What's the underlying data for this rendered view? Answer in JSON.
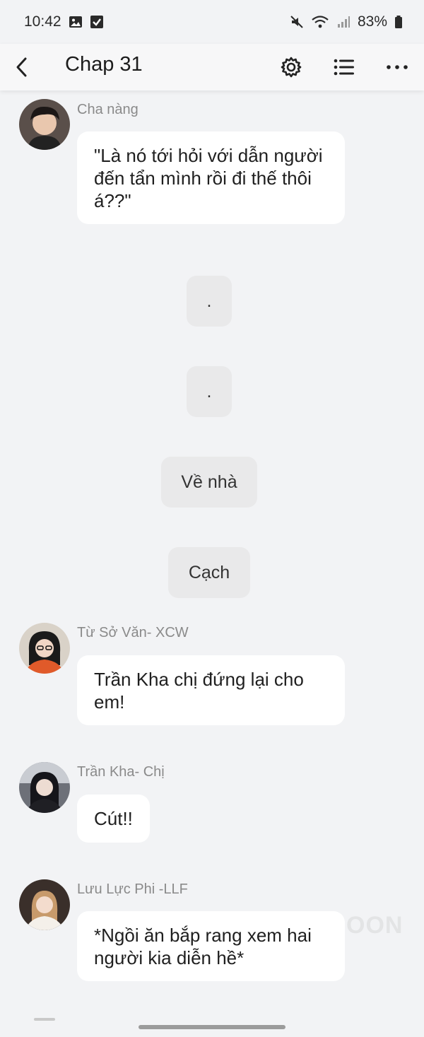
{
  "status_bar": {
    "time": "10:42",
    "battery": "83%"
  },
  "header": {
    "title": "Chap 31"
  },
  "messages": [
    {
      "sender": "Cha nàng",
      "text": "\"Là nó tới hỏi với dẫn người đến tẩn mình rồi đi thế thôi á??\""
    },
    {
      "sender": "Từ Sở Văn- XCW",
      "text": "Trần Kha chị đứng lại cho em!"
    },
    {
      "sender": "Trần Kha- Chị",
      "text": "Cút!!"
    },
    {
      "sender": "Lưu Lực Phi -LLF",
      "text": "*Ngồi ăn bắp rang xem hai người kia diễn hề*"
    }
  ],
  "narration": [
    ".",
    ".",
    "Về nhà",
    "Cạch"
  ],
  "watermark": "OON",
  "icons": [
    "image-icon",
    "checkbox-icon",
    "mute-icon",
    "wifi-icon",
    "signal-icon",
    "battery-icon",
    "back-arrow-icon",
    "settings-gear-icon",
    "list-icon",
    "more-icon"
  ]
}
